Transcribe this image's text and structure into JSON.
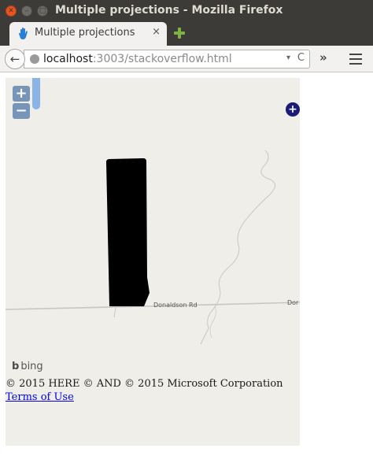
{
  "window": {
    "title": "Multiple projections - Mozilla Firefox"
  },
  "tabs": [
    {
      "label": "Multiple projections",
      "close": "×",
      "active": true
    }
  ],
  "navbar": {
    "back_icon": "←",
    "url_host": "localhost",
    "url_path": ":3003/stackoverflow.html",
    "dropdown_icon": "▾",
    "reload_icon": "C",
    "overflow_icon": "»"
  },
  "map": {
    "zoom_in": "+",
    "zoom_out": "−",
    "overview_toggle": "+",
    "road_label_main": "Donaldson Rd",
    "road_label_cut": "Dor",
    "provider": "bing",
    "attribution": "© 2015 HERE © AND © 2015 Microsoft Corporation",
    "terms_link": "Terms of Use",
    "colors": {
      "background": "#efeee9",
      "polygon": "#000000",
      "road": "#c8c6c0",
      "zoom_button": "rgba(0,60,136,0.5)",
      "link": "#0000ee"
    }
  }
}
